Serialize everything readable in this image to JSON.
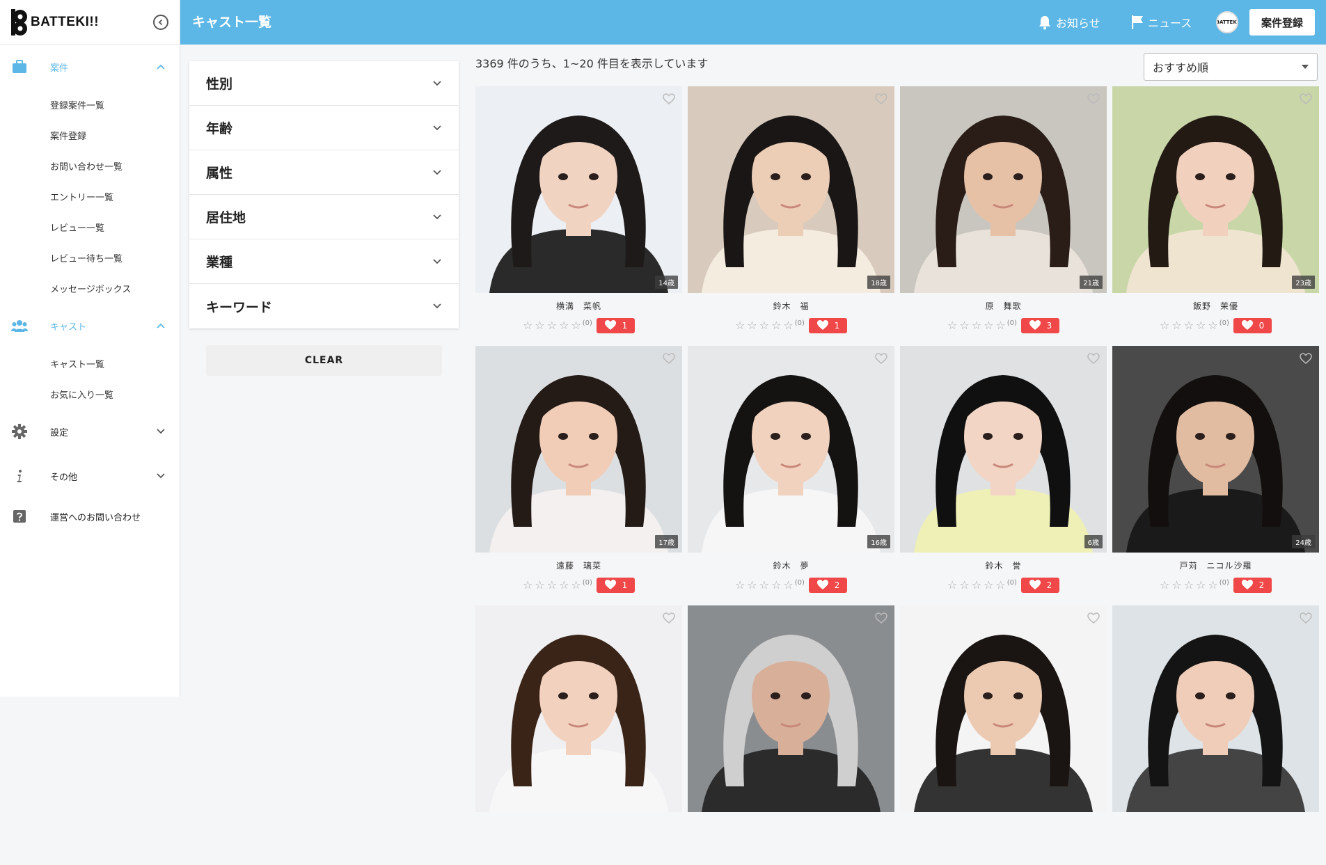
{
  "app": {
    "logo_text": "BATTEKI!!"
  },
  "header": {
    "title": "キャスト一覧",
    "notifications_label": "お知らせ",
    "news_label": "ニュース",
    "register_label": "案件登録",
    "avatar_text": "BATTEKI"
  },
  "sidebar": {
    "groups": [
      {
        "label": "案件",
        "icon": "briefcase-icon",
        "expanded": true,
        "items": [
          "登録案件一覧",
          "案件登録",
          "お問い合わせ一覧",
          "エントリー一覧",
          "レビュー一覧",
          "レビュー待ち一覧",
          "メッセージボックス"
        ]
      },
      {
        "label": "キャスト",
        "icon": "users-icon",
        "expanded": true,
        "items": [
          "キャスト一覧",
          "お気に入り一覧"
        ]
      },
      {
        "label": "設定",
        "icon": "gear-icon",
        "expanded": false,
        "items": []
      },
      {
        "label": "その他",
        "icon": "info-icon",
        "expanded": false,
        "items": []
      },
      {
        "label": "運営へのお問い合わせ",
        "icon": "help-icon",
        "expanded": false,
        "items": []
      }
    ]
  },
  "filters": {
    "items": [
      "性別",
      "年齢",
      "属性",
      "居住地",
      "業種",
      "キーワード"
    ],
    "clear_label": "CLEAR"
  },
  "results": {
    "summary": "3369 件のうち、1~20 件目を表示しています",
    "sort_value": "おすすめ順"
  },
  "cards": [
    {
      "name": "横溝　菜帆",
      "age": "14歳",
      "reviews": "(0)",
      "likes": "1"
    },
    {
      "name": "鈴木　福",
      "age": "18歳",
      "reviews": "(0)",
      "likes": "1"
    },
    {
      "name": "原　舞歌",
      "age": "21歳",
      "reviews": "(0)",
      "likes": "3"
    },
    {
      "name": "飯野　茉優",
      "age": "23歳",
      "reviews": "(0)",
      "likes": "0"
    },
    {
      "name": "遠藤　璃菜",
      "age": "17歳",
      "reviews": "(0)",
      "likes": "1"
    },
    {
      "name": "鈴木　夢",
      "age": "16歳",
      "reviews": "(0)",
      "likes": "2"
    },
    {
      "name": "鈴木　誉",
      "age": "6歳",
      "reviews": "(0)",
      "likes": "2"
    },
    {
      "name": "戸苅　ニコル沙羅",
      "age": "24歳",
      "reviews": "(0)",
      "likes": "2"
    },
    {
      "name": "",
      "age": "",
      "reviews": "",
      "likes": ""
    },
    {
      "name": "",
      "age": "",
      "reviews": "",
      "likes": ""
    },
    {
      "name": "",
      "age": "",
      "reviews": "",
      "likes": ""
    },
    {
      "name": "",
      "age": "",
      "reviews": "",
      "likes": ""
    }
  ],
  "colors": {
    "primary": "#5cb6e6",
    "like": "#f04848"
  }
}
